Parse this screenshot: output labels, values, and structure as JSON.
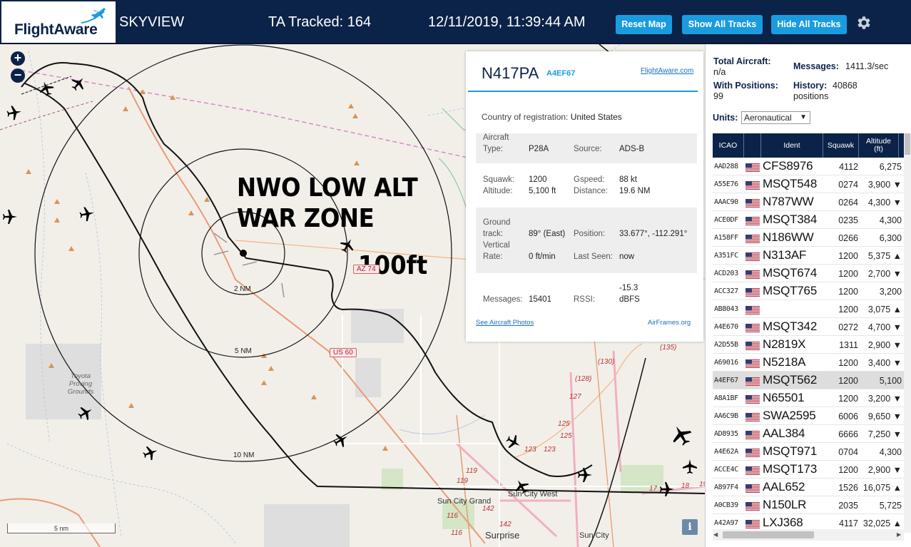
{
  "header": {
    "logo_text": "FlightAware",
    "app_name": "SKYVIEW",
    "ta_tracked": "TA Tracked: 164",
    "datetime": "12/11/2019, 11:39:44 AM",
    "reset_map": "Reset Map",
    "show_all": "Show All Tracks",
    "hide_all": "Hide All Tracks"
  },
  "map": {
    "zoom_in": "+",
    "zoom_out": "−",
    "overlay_title": "NWO LOW ALT WAR ZONE",
    "overlay_title_line1": "NWO LOW ALT",
    "overlay_title_line2": "WAR ZONE",
    "overlay_alt": "100ft",
    "ring_2": "2 NM",
    "ring_5": "5 NM",
    "ring_10": "10 NM",
    "scale": "5 nm",
    "info": "i",
    "labels": {
      "toyota": "Toyota Proving Grounds",
      "sun_city_west": "Sun City West",
      "sun_city_grand": "Sun City Grand",
      "surprise": "Surprise",
      "sun_city": "Sun City",
      "us60": "US 60",
      "a74": "AZ 74"
    },
    "road_numbers": [
      "(128)",
      "(130)",
      "(135)",
      "127",
      "125",
      "125",
      "123",
      "123",
      "119",
      "119",
      "116",
      "142",
      "17",
      "18",
      "19",
      "116",
      "142"
    ]
  },
  "detail": {
    "registration": "N417PA",
    "icao": "A4EF67",
    "fa_link": "FlightAware.com",
    "country_label": "Country of registration:",
    "country": "United States",
    "aircraft_type_label_1": "Aircraft",
    "aircraft_type_label_2": "Type:",
    "aircraft_type": "P28A",
    "source_label": "Source:",
    "source": "ADS-B",
    "squawk_label": "Squawk:",
    "squawk": "1200",
    "altitude_label": "Altitude:",
    "altitude": "5,100 ft",
    "gspeed_label": "Gspeed:",
    "gspeed": "88 kt",
    "distance_label": "Distance:",
    "distance": "19.6 NM",
    "ground_label_1": "Ground",
    "ground_label_2": "track:",
    "ground_track": "89° (East)",
    "position_label": "Position:",
    "position": "33.677°, -112.291°",
    "vrate_label_1": "Vertical",
    "vrate_label_2": "Rate:",
    "vrate": "0 ft/min",
    "lastseen_label": "Last Seen:",
    "lastseen": "now",
    "messages_label": "Messages:",
    "messages": "15401",
    "rssi_label": "RSSI:",
    "rssi_1": "-15.3",
    "rssi_2": "dBFS",
    "photos_link": "See Aircraft Photos",
    "airframes_link": "AirFrames.org"
  },
  "side": {
    "total_label": "Total Aircraft:",
    "total_value": "n/a",
    "messages_label": "Messages:",
    "messages_value": "1411.3/sec",
    "positions_label": "With Positions:",
    "positions_value": "99",
    "history_label": "History:",
    "history_value_1": "40868",
    "history_value_2": "positions",
    "units_label": "Units:",
    "units_value": "Aeronautical",
    "columns": {
      "icao": "ICAO",
      "ident": "Ident",
      "squawk": "Squawk",
      "alt_1": "Altitude",
      "alt_2": "(ft)"
    },
    "rows": [
      {
        "icao": "AAD288",
        "ident": "CFS8976",
        "squawk": "4112",
        "alt": "6,275"
      },
      {
        "icao": "A55E76",
        "ident": "MSQT548",
        "squawk": "0274",
        "alt": "3,900 ▼"
      },
      {
        "icao": "AAAC90",
        "ident": "N787WW",
        "squawk": "0264",
        "alt": "4,300 ▼"
      },
      {
        "icao": "ACE0DF",
        "ident": "MSQT384",
        "squawk": "0235",
        "alt": "4,300"
      },
      {
        "icao": "A158FF",
        "ident": "N186WW",
        "squawk": "0266",
        "alt": "6,300"
      },
      {
        "icao": "A351FC",
        "ident": "N313AF",
        "squawk": "1200",
        "alt": "5,375 ▲"
      },
      {
        "icao": "ACD203",
        "ident": "MSQT674",
        "squawk": "1200",
        "alt": "2,700 ▼"
      },
      {
        "icao": "ACC327",
        "ident": "MSQT765",
        "squawk": "1200",
        "alt": "3,200"
      },
      {
        "icao": "AB8043",
        "ident": "",
        "squawk": "1200",
        "alt": "3,075 ▲"
      },
      {
        "icao": "A4E670",
        "ident": "MSQT342",
        "squawk": "0272",
        "alt": "4,700 ▼"
      },
      {
        "icao": "A2D55B",
        "ident": "N2819X",
        "squawk": "1311",
        "alt": "2,900 ▼"
      },
      {
        "icao": "A69016",
        "ident": "N5218A",
        "squawk": "1200",
        "alt": "3,400 ▼"
      },
      {
        "icao": "A4EF67",
        "ident": "MSQT562",
        "squawk": "1200",
        "alt": "5,100"
      },
      {
        "icao": "A8A1BF",
        "ident": "N65501",
        "squawk": "1200",
        "alt": "3,200 ▼"
      },
      {
        "icao": "AA6C9B",
        "ident": "SWA2595",
        "squawk": "6006",
        "alt": "9,650 ▼"
      },
      {
        "icao": "AD8935",
        "ident": "AAL384",
        "squawk": "6666",
        "alt": "7,250 ▼"
      },
      {
        "icao": "A4E62A",
        "ident": "MSQT971",
        "squawk": "0704",
        "alt": "4,300"
      },
      {
        "icao": "ACCE4C",
        "ident": "MSQT173",
        "squawk": "1200",
        "alt": "2,900 ▼"
      },
      {
        "icao": "A897F4",
        "ident": "AAL652",
        "squawk": "1526",
        "alt": "16,075 ▲"
      },
      {
        "icao": "A0CB39",
        "ident": "N150LR",
        "squawk": "2035",
        "alt": "5,725"
      },
      {
        "icao": "A42A97",
        "ident": "LXJ368",
        "squawk": "4117",
        "alt": "32,025 ▲"
      }
    ]
  },
  "colors": {
    "brand": "#0b2349",
    "accent": "#1a9be0",
    "map_bg": "#f2efe9"
  }
}
